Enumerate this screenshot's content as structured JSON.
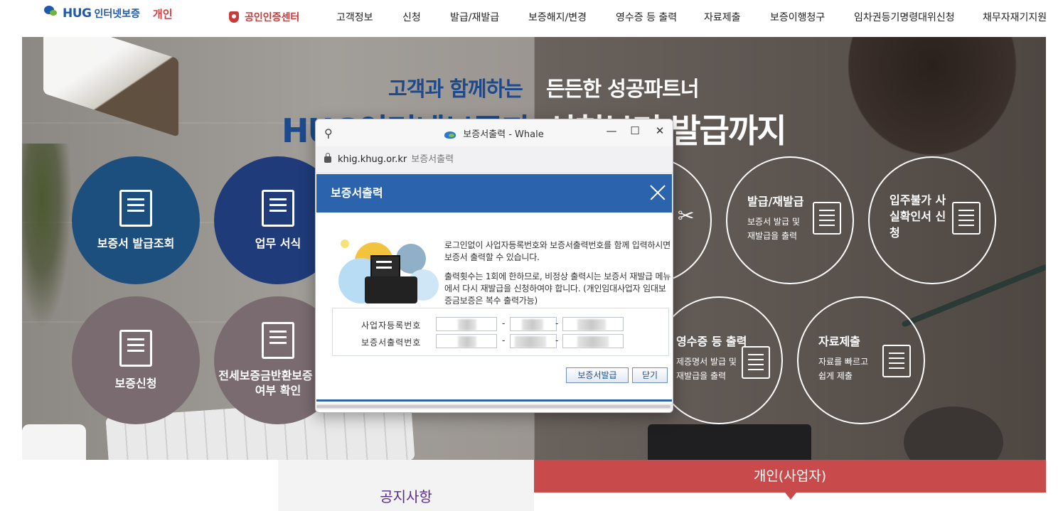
{
  "header": {
    "logo_text": "HUG",
    "logo_sub": "인터넷보증",
    "mode": "개인",
    "cert_center": "공인인증센터",
    "menu": [
      "고객정보",
      "신청",
      "발급/재발급",
      "보증해지/변경",
      "영수증 등 출력",
      "자료제출",
      "보증이행청구",
      "임차권등기명령대위신청",
      "채무자재기지원"
    ]
  },
  "hero": {
    "headline_left_1": "고객과 함께하는",
    "headline_right_1": "든든한 성공파트너",
    "headline_left_2": "HUG인터넷보증과",
    "headline_right_2": "신청부터 발급까지",
    "circles": [
      {
        "label": "보증서 발급조회",
        "color": "#1c4f7e"
      },
      {
        "label": "업무 서식",
        "color": "#1f3b7a"
      },
      {
        "label": "보증신청",
        "color": "#7a6b70"
      },
      {
        "label": "전세보증금반환보증 가능여부 확인",
        "color": "#7a6b70"
      }
    ],
    "rings": [
      {
        "title": "발급/재발급",
        "desc": "보증서 발급 및 재발급을 출력"
      },
      {
        "title": "입주불가 사실확인서 신청",
        "desc": ""
      },
      {
        "title": "영수증 등 출력",
        "desc": "제증명서 발급 및 재발급을 출력"
      },
      {
        "title": "자료제출",
        "desc": "자료를 빠르고 쉽게 제출"
      }
    ]
  },
  "bottom": {
    "notice": "공지사항",
    "personal": "개인(사업자)"
  },
  "popup": {
    "window_title": "보증서출력 - Whale",
    "host": "khig.khug.or.kr",
    "path": "보증서출력",
    "dialog_title": "보증서출력",
    "msg1": "로그인없이 사업자등록번호와 보증서출력번호를 함께 입력하시면 보증서 출력할 수 있습니다.",
    "msg2": "출력횟수는 1회에 한하므로, 비정상 출력시는 보증서 재발급 메뉴에서 다시 재발급을 신청하여야 합니다. (개인임대사업자 임대보증금보증은 복수 출력가능)",
    "label_bizno": "사업자등록번호",
    "label_printno": "보증서출력번호",
    "dash": "-",
    "btn_issue": "보증서발급",
    "btn_close": "닫기"
  }
}
